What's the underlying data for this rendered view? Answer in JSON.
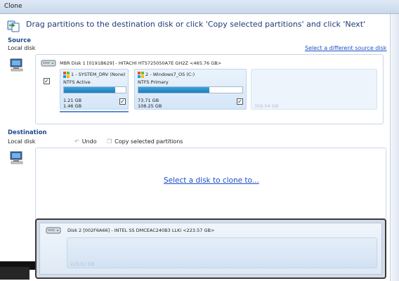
{
  "window": {
    "title": "Clone"
  },
  "header": {
    "instruction": "Drag partitions to the destination disk or click 'Copy selected partitions' and click 'Next'"
  },
  "source": {
    "title": "Source",
    "subtitle": "Local disk",
    "select_link": "Select a different source disk",
    "disk": {
      "label": "MBR Disk 1 [0191B629] - HITACHI   HTS725050A7E   GH2Z  <465.76 GB>",
      "checked": true,
      "partitions": [
        {
          "name": "1 - SYSTEM_DRV (None)",
          "type": "NTFS Active",
          "used": "1.21 GB",
          "total": "1.46 GB",
          "fill": 0.83,
          "checked": true
        },
        {
          "name": "2 - Windows7_OS (C:)",
          "type": "NTFS Primary",
          "used": "73.71 GB",
          "total": "108.25 GB",
          "fill": 0.68,
          "checked": true
        }
      ],
      "unallocated": "356.04 GB"
    }
  },
  "destination": {
    "title": "Destination",
    "subtitle": "Local disk",
    "undo_label": "Undo",
    "copy_label": "Copy selected partitions",
    "clone_link": "Select a disk to clone to...",
    "candidate_disk": {
      "label": "Disk 2 [002F6A66] - INTEL SS DMCEAC240B3    LLKi  <223.57 GB>",
      "size": "223.57 GB"
    }
  },
  "colors": {
    "accent": "#1a7cc0",
    "link": "#1a50c8",
    "heading": "#1e3a78"
  },
  "icons": [
    "clone-header-icon",
    "computer-icon",
    "disk-drive-icon",
    "windows-logo-icon",
    "undo-arrow-icon",
    "copy-icon"
  ]
}
